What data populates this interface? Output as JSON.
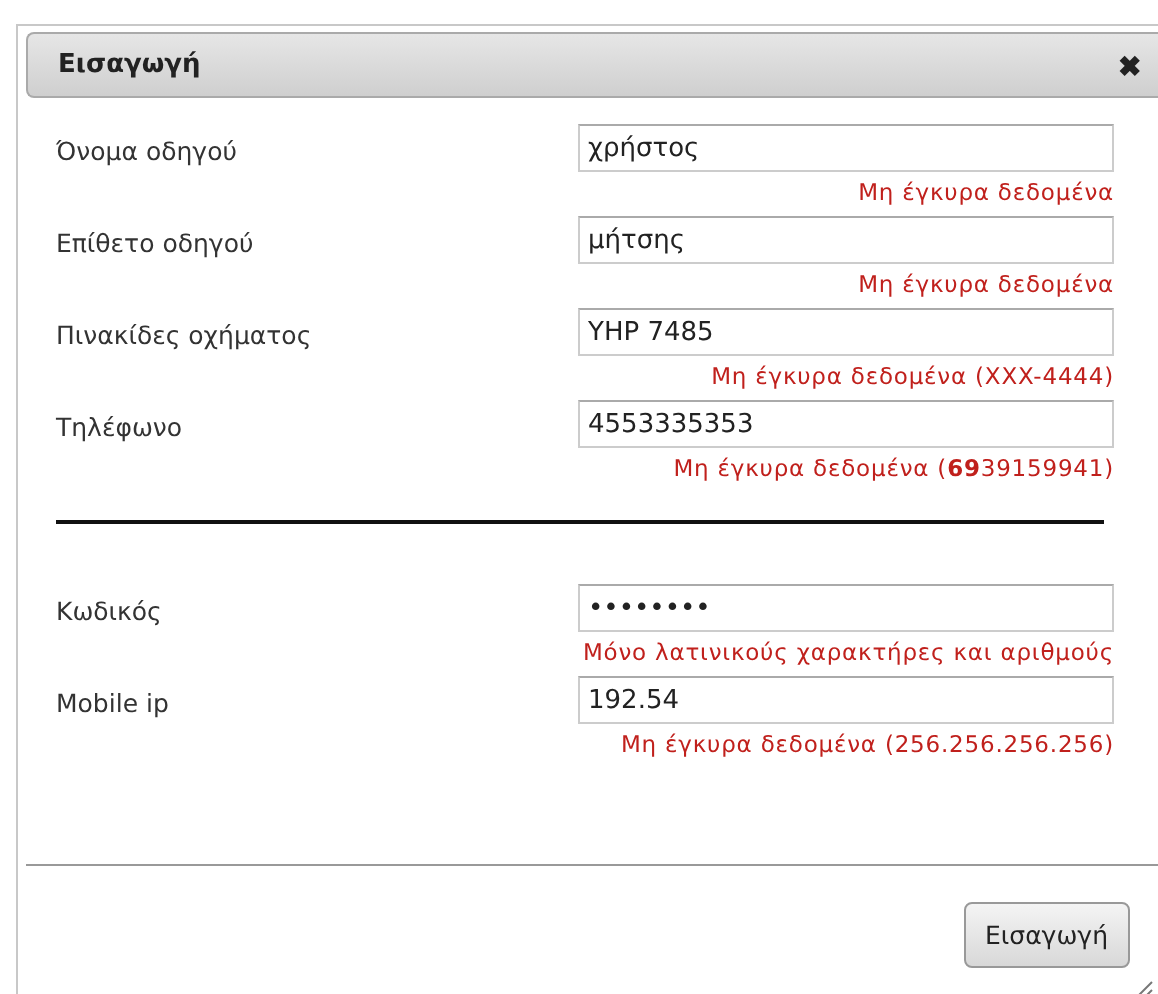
{
  "dialog": {
    "title": "Εισαγωγή",
    "close": "✖"
  },
  "groups": [
    {
      "fields": [
        {
          "label": "Όνομα οδηγού",
          "value": "χρήστος",
          "error": "Μη έγκυρα δεδομένα"
        },
        {
          "label": "Επίθετο οδηγού",
          "value": "μήτσης",
          "error": "Μη έγκυρα δεδομένα"
        },
        {
          "label": "Πινακίδες οχήματος",
          "value": "YHP 7485",
          "error": "Μη έγκυρα δεδομένα (XXX-4444)"
        },
        {
          "label": "Τηλέφωνο",
          "value": "4553335353",
          "error": "Μη έγκυρα δεδομένα (**69**39159941)"
        }
      ]
    },
    {
      "fields": [
        {
          "label": "Κωδικός",
          "value": "••••••••",
          "error": "Μόνο λατινικούς χαρακτήρες και αριθμούς"
        },
        {
          "label": "Mobile ip",
          "value": "192.54",
          "error": "Μη έγκυρα δεδομένα (256.256.256.256)"
        }
      ]
    }
  ],
  "buttons": [
    "Εισαγωγή"
  ]
}
